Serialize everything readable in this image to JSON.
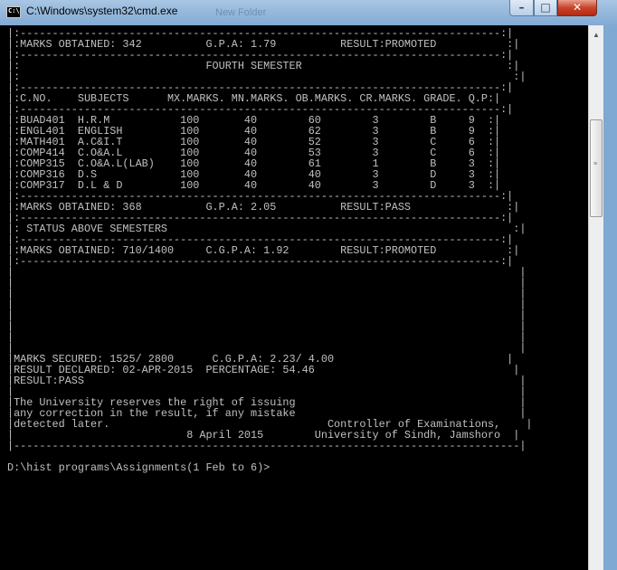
{
  "window": {
    "title": "C:\\Windows\\system32\\cmd.exe",
    "ghost_title": "New Folder"
  },
  "console": {
    "lines": [
      "|:---------------------------------------------------------------------------:|",
      "|:MARKS OBTAINED: 342          G.P.A: 1.79          RESULT:PROMOTED           :|",
      "|:---------------------------------------------------------------------------:|",
      "|:                             FOURTH SEMESTER                                :|",
      "|:                                                                             :|",
      "|:---------------------------------------------------------------------------:|",
      "|:C.NO.    SUBJECTS      MX.MARKS. MN.MARKS. OB.MARKS. CR.MARKS. GRADE. Q.P:|",
      "|:---------------------------------------------------------------------------:|",
      "|:BUAD401  H.R.M           100       40        60        3        B     9  :|",
      "|:ENGL401  ENGLISH         100       40        62        3        B     9  :|",
      "|:MATH401  A.C&I.T         100       40        52        3        C     6  :|",
      "|:COMP414  C.O&A.L         100       40        53        3        C     6  :|",
      "|:COMP315  C.O&A.L(LAB)    100       40        61        1        B     3  :|",
      "|:COMP316  D.S             100       40        40        3        D     3  :|",
      "|:COMP317  D.L & D         100       40        40        3        D     3  :|",
      "|:---------------------------------------------------------------------------:|",
      "|:MARKS OBTAINED: 368          G.P.A: 2.05          RESULT:PASS               :|",
      "|:---------------------------------------------------------------------------:|",
      "|: STATUS ABOVE SEMESTERS                                                      :|",
      "|:---------------------------------------------------------------------------:|",
      "|:MARKS OBTAINED: 710/1400     C.G.P.A: 1.92        RESULT:PROMOTED           :|",
      "|:---------------------------------------------------------------------------:|",
      "|                                                                               |",
      "|                                                                               |",
      "|                                                                               |",
      "|                                                                               |",
      "|                                                                               |",
      "|                                                                               |",
      "|                                                                               |",
      "|                                                                               |",
      "|MARKS SECURED: 1525/ 2800      C.G.P.A: 2.23/ 4.00                           |",
      "|RESULT DECLARED: 02-APR-2015  PERCENTAGE: 54.46                               |",
      "|RESULT:PASS                                                                    |",
      "|                                                                               |",
      "|The University reserves the right of issuing                                   |",
      "|any correction in the result, if any mistake                                   |",
      "|detected later.                                  Controller of Examinations,    |",
      "|                           8 April 2015        University of Sindh, Jamshoro  |",
      "|-------------------------------------------------------------------------------|",
      "",
      "D:\\hist programs\\Assignments(1 Feb to 6)>"
    ]
  },
  "controls": {
    "minimize": "–",
    "maximize": "□",
    "close": "✕",
    "scroll_up": "▲"
  },
  "icons": {
    "app": "cmd-icon"
  }
}
